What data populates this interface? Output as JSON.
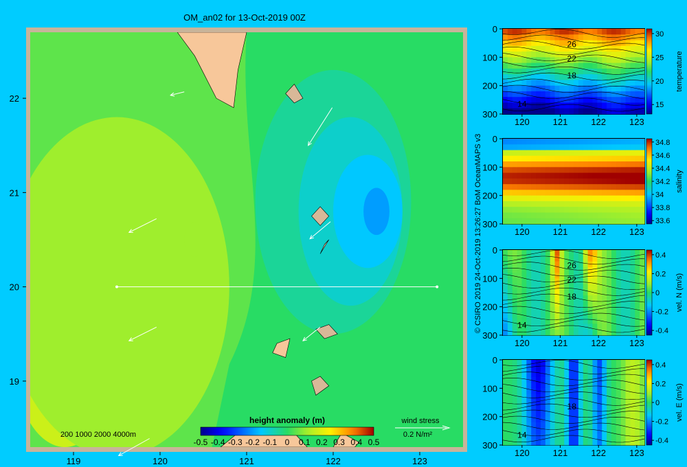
{
  "title": "OM_an02 for 13-Oct-2019 00Z",
  "credit": "© CSIRO 2019  24-Oct-2019 13:26:27 BoM OceanMAPS v3",
  "colors": {
    "background": "#00ccff",
    "frame": "#c8b49a",
    "land": "#f7c79a",
    "shelf": "#d8b898"
  },
  "chart_data": [
    {
      "type": "heatmap",
      "name": "map",
      "title": "OM_an02 for 13-Oct-2019 00Z",
      "xlim": [
        118.5,
        123.5
      ],
      "ylim": [
        18.3,
        22.7
      ],
      "xticks": [
        119,
        120,
        121,
        122,
        123
      ],
      "yticks": [
        19,
        20,
        21,
        22
      ],
      "colorbar": {
        "label": "height anomaly (m)",
        "ticks": [
          "-0.5",
          "-0.4",
          "-0.3",
          "-0.2",
          "-0.1",
          "0",
          "0.1",
          "0.2",
          "0.3",
          "0.4",
          "0.5"
        ],
        "range": [
          -0.5,
          0.5
        ]
      },
      "depth_legend": "200  1000  2000  4000m",
      "wind_stress_label": "wind stress",
      "wind_stress_scale": "0.2 N/m²",
      "transect": {
        "lat": 20.0,
        "lon_start": 119.5,
        "lon_end": 123.2
      },
      "vectors": [
        {
          "lon": 120.2,
          "lat": 22.05,
          "u": -0.2,
          "v": -0.05
        },
        {
          "lon": 121.85,
          "lat": 21.7,
          "u": -0.35,
          "v": -0.55
        },
        {
          "lon": 119.8,
          "lat": 20.65,
          "u": -0.4,
          "v": -0.2
        },
        {
          "lon": 121.85,
          "lat": 20.6,
          "u": -0.3,
          "v": -0.25
        },
        {
          "lon": 119.8,
          "lat": 19.5,
          "u": -0.4,
          "v": -0.2
        },
        {
          "lon": 121.75,
          "lat": 19.5,
          "u": -0.25,
          "v": -0.2
        },
        {
          "lon": 119.7,
          "lat": 18.3,
          "u": -0.45,
          "v": -0.25
        }
      ],
      "anomaly_regions": [
        {
          "level": 0.17,
          "lon": 118.9,
          "lat": 19.3,
          "rx": 0.6,
          "ry": 1.0
        },
        {
          "level": 0.11,
          "lon": 119.5,
          "lat": 20.0,
          "rx": 1.3,
          "ry": 1.8
        },
        {
          "level": 0.11,
          "lon": 120.4,
          "lat": 20.5,
          "rx": 0.12,
          "ry": 0.18
        },
        {
          "level": -0.05,
          "lon": 122.0,
          "lat": 20.9,
          "rx": 0.9,
          "ry": 1.4
        },
        {
          "level": -0.1,
          "lon": 122.2,
          "lat": 20.8,
          "rx": 0.6,
          "ry": 1.0
        },
        {
          "level": -0.15,
          "lon": 122.4,
          "lat": 20.8,
          "rx": 0.4,
          "ry": 0.6
        },
        {
          "level": -0.2,
          "lon": 122.5,
          "lat": 20.8,
          "rx": 0.15,
          "ry": 0.25
        }
      ]
    },
    {
      "type": "heatmap",
      "name": "temperature-section",
      "xlim": [
        119.5,
        123.2
      ],
      "ylim": [
        300,
        0
      ],
      "xticks": [
        120,
        121,
        122,
        123
      ],
      "yticks": [
        0,
        100,
        200,
        300
      ],
      "colorbar_label": "temperature",
      "colorbar_ticks": [
        "30",
        "25",
        "20",
        "15"
      ],
      "colorbar_range": [
        13,
        31
      ],
      "contour_labels": [
        {
          "text": "26",
          "lon": 121.3,
          "depth": 55
        },
        {
          "text": "22",
          "lon": 121.3,
          "depth": 105
        },
        {
          "text": "18",
          "lon": 121.3,
          "depth": 165
        },
        {
          "text": "14",
          "lon": 120.0,
          "depth": 265
        }
      ]
    },
    {
      "type": "heatmap",
      "name": "salinity-section",
      "xlim": [
        119.5,
        123.2
      ],
      "ylim": [
        300,
        0
      ],
      "xticks": [
        120,
        121,
        122,
        123
      ],
      "yticks": [
        0,
        100,
        200,
        300
      ],
      "colorbar_label": "salinity",
      "colorbar_ticks": [
        "34.8",
        "34.6",
        "34.4",
        "34.2",
        "34",
        "33.8",
        "33.6"
      ],
      "colorbar_range": [
        33.55,
        34.85
      ]
    },
    {
      "type": "heatmap",
      "name": "vel-n-section",
      "xlim": [
        119.5,
        123.2
      ],
      "ylim": [
        300,
        0
      ],
      "xticks": [
        120,
        121,
        122,
        123
      ],
      "yticks": [
        0,
        100,
        200,
        300
      ],
      "colorbar_label": "vel. N (m/s)",
      "colorbar_ticks": [
        "0.4",
        "0.2",
        "0",
        "-0.2",
        "-0.4"
      ],
      "colorbar_range": [
        -0.45,
        0.45
      ],
      "contour_labels": [
        {
          "text": "26",
          "lon": 121.3,
          "depth": 55
        },
        {
          "text": "22",
          "lon": 121.3,
          "depth": 105
        },
        {
          "text": "18",
          "lon": 121.3,
          "depth": 165
        },
        {
          "text": "14",
          "lon": 120.0,
          "depth": 265
        }
      ]
    },
    {
      "type": "heatmap",
      "name": "vel-e-section",
      "xlim": [
        119.5,
        123.2
      ],
      "ylim": [
        300,
        0
      ],
      "xticks": [
        120,
        121,
        122,
        123
      ],
      "yticks": [
        0,
        100,
        200,
        300
      ],
      "colorbar_label": "vel. E (m/s)",
      "colorbar_ticks": [
        "0.4",
        "0.2",
        "0",
        "-0.2",
        "-0.4"
      ],
      "colorbar_range": [
        -0.45,
        0.45
      ],
      "contour_labels": [
        {
          "text": "18",
          "lon": 121.3,
          "depth": 165
        },
        {
          "text": "14",
          "lon": 120.0,
          "depth": 265
        }
      ]
    }
  ]
}
